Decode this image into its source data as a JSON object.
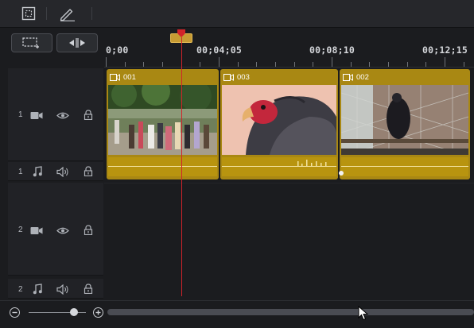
{
  "ruler": {
    "timecodes": [
      "0;00",
      "00;04;05",
      "00;08;10",
      "00;12;15"
    ]
  },
  "tracks": [
    {
      "number": "1",
      "kind": "video",
      "icons": [
        "video-camera-icon",
        "eye-icon",
        "lock-icon"
      ]
    },
    {
      "number": "1",
      "kind": "audio",
      "icons": [
        "music-note-icon",
        "speaker-icon",
        "lock-icon"
      ]
    },
    {
      "number": "2",
      "kind": "video",
      "icons": [
        "video-camera-icon",
        "eye-icon",
        "lock-icon"
      ]
    },
    {
      "number": "2",
      "kind": "audio",
      "icons": [
        "music-note-icon",
        "speaker-icon",
        "lock-icon"
      ]
    }
  ],
  "clips": [
    {
      "label": "001",
      "scene": "crowd-street"
    },
    {
      "label": "003",
      "scene": "vulture-closeup"
    },
    {
      "label": "002",
      "scene": "bird-in-cage"
    }
  ],
  "colors": {
    "clip": "#a98813",
    "playhead": "#d2232a",
    "accent": "#c79b33"
  }
}
